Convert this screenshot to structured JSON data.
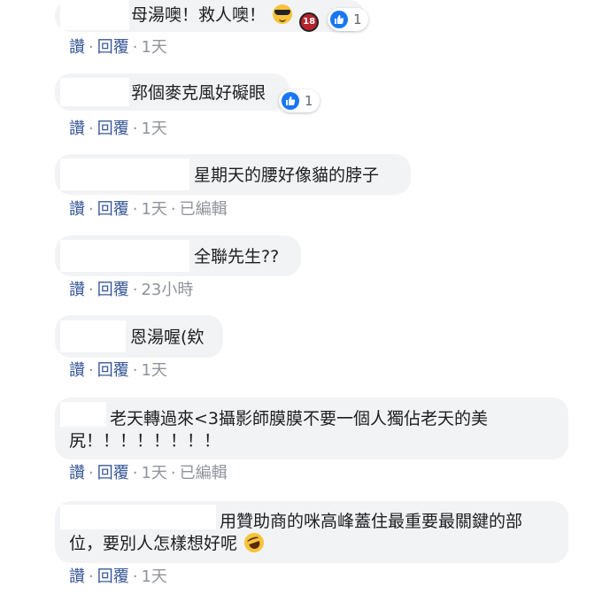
{
  "comments": [
    {
      "text": "母湯噢！救人噢！",
      "emojis": [
        "sunglasses-emoji",
        "18-emoji"
      ],
      "reactions": "1",
      "actions": {
        "like": "讚",
        "reply": "回覆",
        "time": "1天",
        "edited": ""
      }
    },
    {
      "text": "郛個麥克風好礙眼",
      "reactions": "1",
      "actions": {
        "like": "讚",
        "reply": "回覆",
        "time": "1天",
        "edited": ""
      }
    },
    {
      "text": "星期天的腰好像貓的脖子",
      "actions": {
        "like": "讚",
        "reply": "回覆",
        "time": "1天",
        "edited": "已編輯"
      }
    },
    {
      "text": "全聯先生??",
      "actions": {
        "like": "讚",
        "reply": "回覆",
        "time": "23小時",
        "edited": ""
      }
    },
    {
      "text": "恩湯喔(欸",
      "actions": {
        "like": "讚",
        "reply": "回覆",
        "time": "1天",
        "edited": ""
      }
    },
    {
      "text_line1": "老天轉過來<3攝影師膜膜不要一個人獨佔老天的美",
      "text_line2": "尻！！！！！！！！",
      "actions": {
        "like": "讚",
        "reply": "回覆",
        "time": "1天",
        "edited": "已編輯"
      }
    },
    {
      "text_line1": "用贊助商的咪高峰蓋住最重要最關鍵的部",
      "text_line2": "位，要別人怎樣想好呢",
      "emojis": [
        "rolling-laughing-emoji"
      ],
      "actions": {
        "like": "讚",
        "reply": "回覆",
        "time": "1天",
        "edited": ""
      }
    }
  ],
  "colors": {
    "bubble": "#f2f3f5",
    "link": "#385898",
    "meta": "#90949c",
    "like": "#1877f2"
  }
}
